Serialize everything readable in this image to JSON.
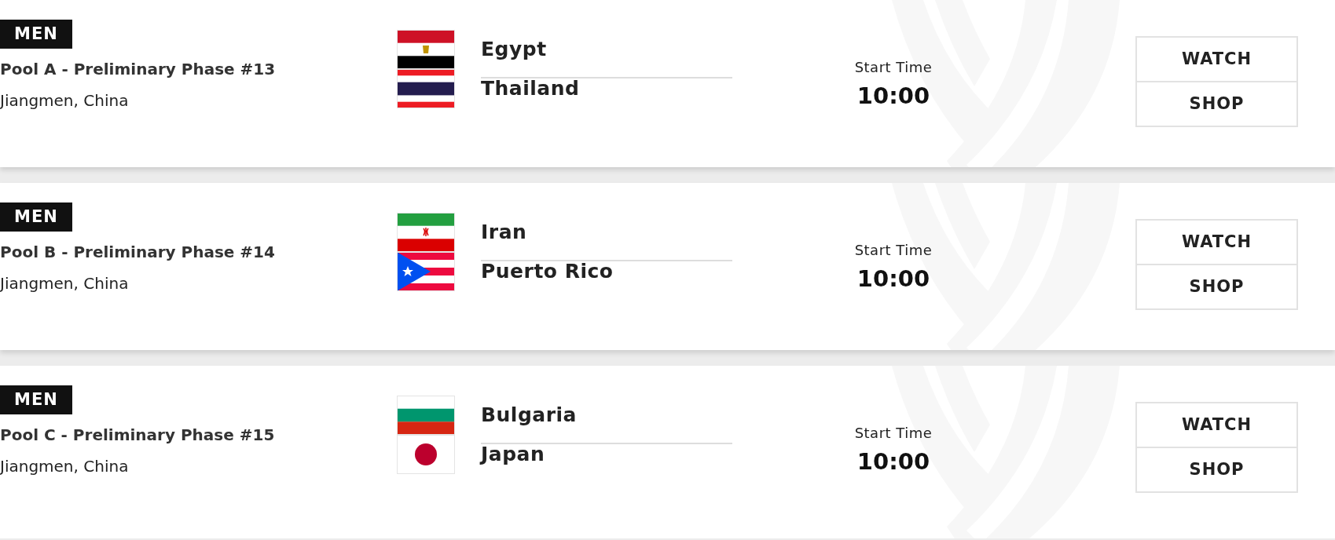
{
  "matches": [
    {
      "category": "MEN",
      "title": "Pool A - Preliminary Phase #13",
      "location": "Jiangmen, China",
      "teams": [
        {
          "name": "Egypt"
        },
        {
          "name": "Thailand"
        }
      ],
      "start_label": "Start Time",
      "start_time": "10:00",
      "buttons": [
        "WATCH",
        "SHOP"
      ]
    },
    {
      "category": "MEN",
      "title": "Pool B - Preliminary Phase #14",
      "location": "Jiangmen, China",
      "teams": [
        {
          "name": "Iran"
        },
        {
          "name": "Puerto Rico"
        }
      ],
      "start_label": "Start Time",
      "start_time": "10:00",
      "buttons": [
        "WATCH",
        "SHOP"
      ]
    },
    {
      "category": "MEN",
      "title": "Pool C - Preliminary Phase #15",
      "location": "Jiangmen, China",
      "teams": [
        {
          "name": "Bulgaria"
        },
        {
          "name": "Japan"
        }
      ],
      "start_label": "Start Time",
      "start_time": "10:00",
      "buttons": [
        "WATCH",
        "SHOP"
      ]
    }
  ]
}
